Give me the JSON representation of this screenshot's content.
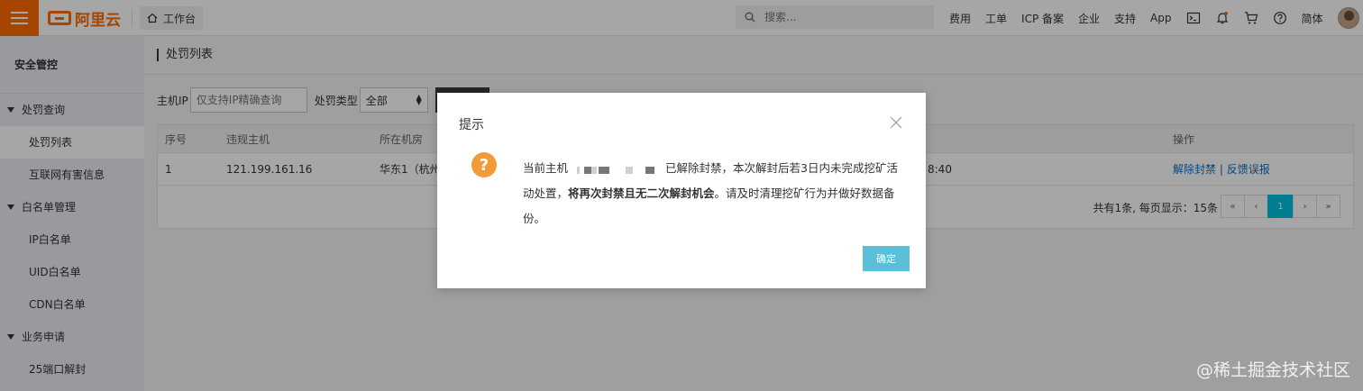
{
  "topbar": {
    "brand": "阿里云",
    "workbench": "工作台",
    "search_placeholder": "搜索...",
    "nav": [
      "费用",
      "工单",
      "ICP 备案",
      "企业",
      "支持",
      "App"
    ],
    "lang": "简体",
    "accent": "#ff6a00"
  },
  "sidebar": {
    "title": "安全管控",
    "groups": [
      {
        "label": "处罚查询",
        "items": [
          "处罚列表",
          "互联网有害信息"
        ]
      },
      {
        "label": "白名单管理",
        "items": [
          "IP白名单",
          "UID白名单",
          "CDN白名单"
        ]
      },
      {
        "label": "业务申请",
        "items": [
          "25端口解封"
        ]
      }
    ]
  },
  "main": {
    "title": "处罚列表",
    "filter": {
      "host_ip_label": "主机IP",
      "host_ip_placeholder": "仅支持IP精确查询",
      "type_label": "处罚类型",
      "type_value": "全部"
    },
    "table": {
      "columns": [
        "序号",
        "违规主机",
        "所在机房",
        "操作"
      ],
      "rows": [
        {
          "index": "1",
          "host": "121.199.161.16",
          "room": "华东1（杭州）",
          "time_tail": "8:40",
          "action_unban": "解除封禁",
          "action_sep": "|",
          "action_report": "反馈误报"
        }
      ],
      "pager_info": "共有1条, 每页显示：15条",
      "pager": [
        "«",
        "‹",
        "1",
        "›",
        "»"
      ]
    }
  },
  "modal": {
    "title": "提示",
    "body_prefix": "当前主机",
    "body_mid": "已解除封禁，本次解封后若3日内未完成挖矿活动处置，",
    "body_bold": "将再次封禁且无二次解封机会",
    "body_suffix": "。请及时清理挖矿行为并做好数据备份。",
    "ok_label": "确定"
  },
  "watermark": "@稀土掘金技术社区"
}
